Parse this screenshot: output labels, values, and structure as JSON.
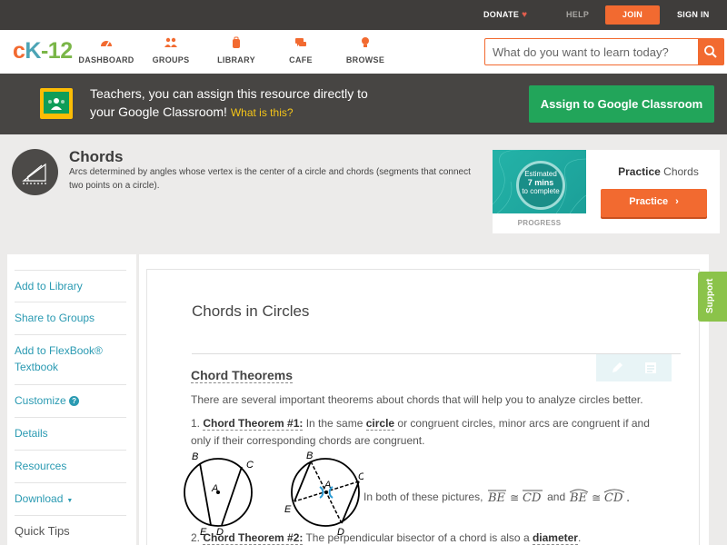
{
  "topbar": {
    "donate": "DONATE",
    "help": "HELP",
    "join": "JOIN",
    "signin": "SIGN IN"
  },
  "nav": {
    "logo": {
      "c": "c",
      "k": "K",
      "dash": "-",
      "num": "12"
    },
    "items": [
      {
        "label": "DASHBOARD",
        "icon": "gauge-icon"
      },
      {
        "label": "GROUPS",
        "icon": "people-icon"
      },
      {
        "label": "LIBRARY",
        "icon": "backpack-icon"
      },
      {
        "label": "CAFE",
        "icon": "chat-icon"
      },
      {
        "label": "BROWSE",
        "icon": "lightbulb-icon"
      }
    ],
    "search_placeholder": "What do you want to learn today?"
  },
  "classroom_banner": {
    "line1": "Teachers, you can assign this resource directly to",
    "line2": "your Google Classroom!",
    "what": "What is this?",
    "button": "Assign to Google Classroom"
  },
  "concept": {
    "title": "Chords",
    "description": "Arcs determined by angles whose vertex is the center of a circle and chords (segments that connect two points on a circle)."
  },
  "practice": {
    "badge_estimated": "Estimated",
    "badge_minutes": "7 mins",
    "badge_complete": "to complete",
    "progress_label": "PROGRESS",
    "title_bold": "Practice",
    "title_rest": " Chords",
    "button": "Practice"
  },
  "sidebar": {
    "items": [
      "Add to Library",
      "Share to Groups",
      "Add to FlexBook®",
      "Textbook",
      "Customize",
      "Details",
      "Resources",
      "Download"
    ],
    "quick_tips": "Quick Tips"
  },
  "article": {
    "title": "Chords in Circles",
    "section_heading": "Chord Theorems",
    "intro": "There are several important theorems about chords that will help you to analyze circles better.",
    "t1_num": "1. ",
    "t1_label": "Chord Theorem #1:",
    "t1_text_a": " In the same ",
    "t1_circle": "circle",
    "t1_text_b": " or congruent circles, minor arcs are congruent if and",
    "t1_text_c": "only if their corresponding chords are congruent.",
    "fig_caption": "In both of these pictures,",
    "fig_and": "and",
    "t2_num": "2. ",
    "t2_label": "Chord Theorem #2:",
    "t2_text": " The perpendicular bisector of a chord is also a ",
    "t2_diameter": "diameter",
    "t2_end": "."
  },
  "support": "Support"
}
